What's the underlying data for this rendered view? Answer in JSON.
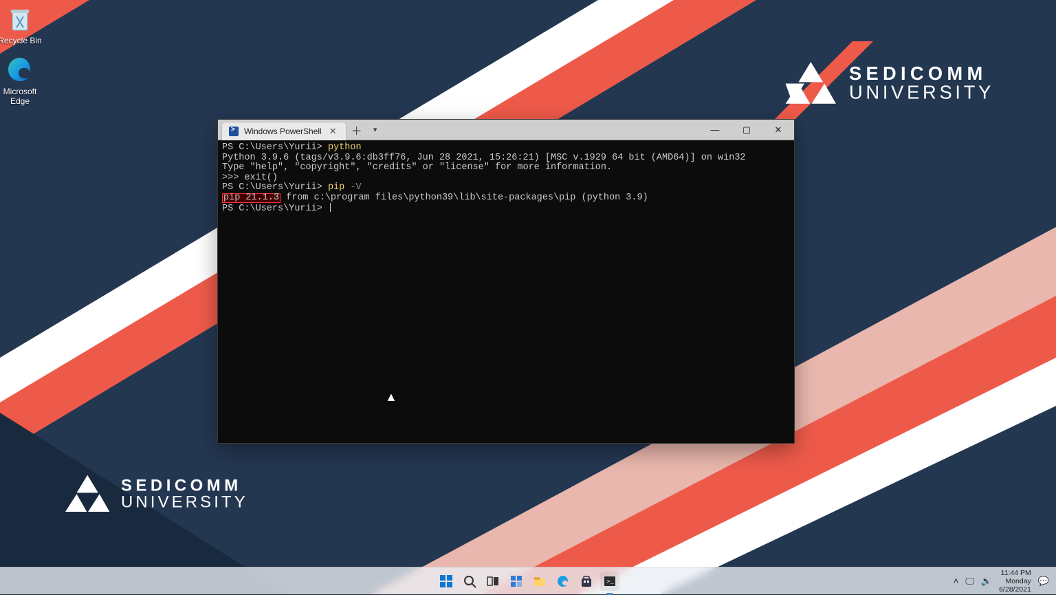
{
  "desktop": {
    "icons": {
      "recycle_bin": "Recycle Bin",
      "edge": "Microsoft Edge"
    }
  },
  "brand": {
    "line1": "SEDICOMM",
    "line2": "UNIVERSITY"
  },
  "window": {
    "tab_title": "Windows PowerShell",
    "terminal": {
      "prompt": "PS C:\\Users\\Yurii> ",
      "lines": {
        "l1_cmd": "python",
        "l2": "Python 3.9.6 (tags/v3.9.6:db3ff76, Jun 28 2021, 15:26:21) [MSC v.1929 64 bit (AMD64)] on win32",
        "l3": "Type \"help\", \"copyright\", \"credits\" or \"license\" for more information.",
        "l4": ">>> exit()",
        "l5_cmd": "pip",
        "l5_opt": " -V",
        "l6_hl": "pip 21.1.3",
        "l6_rest": " from c:\\program files\\python39\\lib\\site-packages\\pip (python 3.9)"
      }
    }
  },
  "taskbar": {
    "time": "11:44 PM",
    "day": "Monday",
    "date": "6/28/2021"
  }
}
